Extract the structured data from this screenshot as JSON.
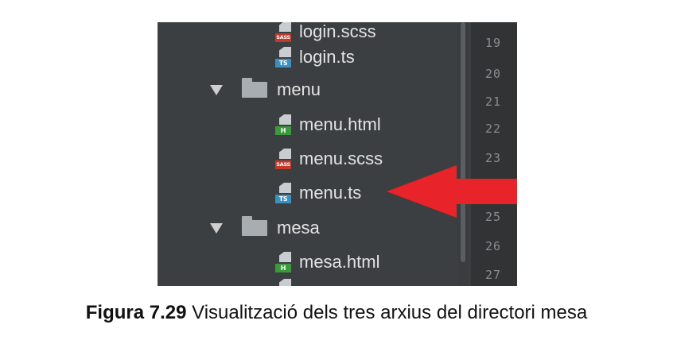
{
  "tree": {
    "rows": [
      {
        "kind": "file",
        "name": "login.scss",
        "icon": "sass-file-icon",
        "tag": "SASS"
      },
      {
        "kind": "file",
        "name": "login.ts",
        "icon": "ts-file-icon",
        "tag": "TS"
      },
      {
        "kind": "folder",
        "name": "menu",
        "icon": "folder-icon",
        "expanded": true
      },
      {
        "kind": "file",
        "name": "menu.html",
        "icon": "html-file-icon",
        "tag": "H"
      },
      {
        "kind": "file",
        "name": "menu.scss",
        "icon": "sass-file-icon",
        "tag": "SASS"
      },
      {
        "kind": "file",
        "name": "menu.ts",
        "icon": "ts-file-icon",
        "tag": "TS"
      },
      {
        "kind": "folder",
        "name": "mesa",
        "icon": "folder-icon",
        "expanded": true
      },
      {
        "kind": "file",
        "name": "mesa.html",
        "icon": "html-file-icon",
        "tag": "H"
      }
    ]
  },
  "line_numbers": [
    "19",
    "20",
    "21",
    "22",
    "23",
    "25",
    "26",
    "27"
  ],
  "colors": {
    "panel_bg": "#3c3f41",
    "gutter_bg": "#313335",
    "arrow": "#e8232a",
    "ts_tag": "#3c8fbf",
    "html_tag": "#3c9a3c",
    "sass_tag": "#c0392b"
  },
  "caption": {
    "label": "Figura 7.29",
    "text": " Visualització dels tres arxius del directori mesa"
  }
}
